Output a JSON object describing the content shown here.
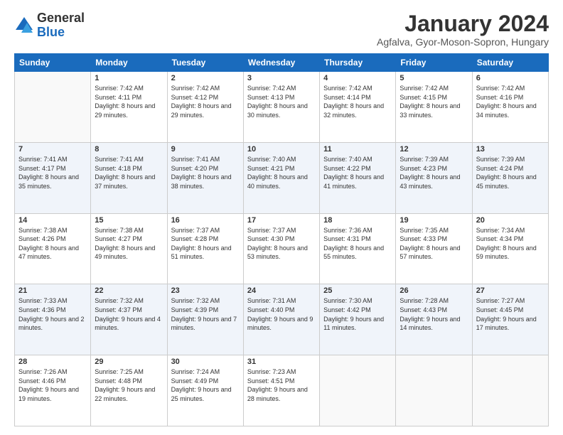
{
  "logo": {
    "general": "General",
    "blue": "Blue"
  },
  "header": {
    "month": "January 2024",
    "location": "Agfalva, Gyor-Moson-Sopron, Hungary"
  },
  "weekdays": [
    "Sunday",
    "Monday",
    "Tuesday",
    "Wednesday",
    "Thursday",
    "Friday",
    "Saturday"
  ],
  "weeks": [
    [
      {
        "day": "",
        "sunrise": "",
        "sunset": "",
        "daylight": ""
      },
      {
        "day": "1",
        "sunrise": "Sunrise: 7:42 AM",
        "sunset": "Sunset: 4:11 PM",
        "daylight": "Daylight: 8 hours and 29 minutes."
      },
      {
        "day": "2",
        "sunrise": "Sunrise: 7:42 AM",
        "sunset": "Sunset: 4:12 PM",
        "daylight": "Daylight: 8 hours and 29 minutes."
      },
      {
        "day": "3",
        "sunrise": "Sunrise: 7:42 AM",
        "sunset": "Sunset: 4:13 PM",
        "daylight": "Daylight: 8 hours and 30 minutes."
      },
      {
        "day": "4",
        "sunrise": "Sunrise: 7:42 AM",
        "sunset": "Sunset: 4:14 PM",
        "daylight": "Daylight: 8 hours and 32 minutes."
      },
      {
        "day": "5",
        "sunrise": "Sunrise: 7:42 AM",
        "sunset": "Sunset: 4:15 PM",
        "daylight": "Daylight: 8 hours and 33 minutes."
      },
      {
        "day": "6",
        "sunrise": "Sunrise: 7:42 AM",
        "sunset": "Sunset: 4:16 PM",
        "daylight": "Daylight: 8 hours and 34 minutes."
      }
    ],
    [
      {
        "day": "7",
        "sunrise": "Sunrise: 7:41 AM",
        "sunset": "Sunset: 4:17 PM",
        "daylight": "Daylight: 8 hours and 35 minutes."
      },
      {
        "day": "8",
        "sunrise": "Sunrise: 7:41 AM",
        "sunset": "Sunset: 4:18 PM",
        "daylight": "Daylight: 8 hours and 37 minutes."
      },
      {
        "day": "9",
        "sunrise": "Sunrise: 7:41 AM",
        "sunset": "Sunset: 4:20 PM",
        "daylight": "Daylight: 8 hours and 38 minutes."
      },
      {
        "day": "10",
        "sunrise": "Sunrise: 7:40 AM",
        "sunset": "Sunset: 4:21 PM",
        "daylight": "Daylight: 8 hours and 40 minutes."
      },
      {
        "day": "11",
        "sunrise": "Sunrise: 7:40 AM",
        "sunset": "Sunset: 4:22 PM",
        "daylight": "Daylight: 8 hours and 41 minutes."
      },
      {
        "day": "12",
        "sunrise": "Sunrise: 7:39 AM",
        "sunset": "Sunset: 4:23 PM",
        "daylight": "Daylight: 8 hours and 43 minutes."
      },
      {
        "day": "13",
        "sunrise": "Sunrise: 7:39 AM",
        "sunset": "Sunset: 4:24 PM",
        "daylight": "Daylight: 8 hours and 45 minutes."
      }
    ],
    [
      {
        "day": "14",
        "sunrise": "Sunrise: 7:38 AM",
        "sunset": "Sunset: 4:26 PM",
        "daylight": "Daylight: 8 hours and 47 minutes."
      },
      {
        "day": "15",
        "sunrise": "Sunrise: 7:38 AM",
        "sunset": "Sunset: 4:27 PM",
        "daylight": "Daylight: 8 hours and 49 minutes."
      },
      {
        "day": "16",
        "sunrise": "Sunrise: 7:37 AM",
        "sunset": "Sunset: 4:28 PM",
        "daylight": "Daylight: 8 hours and 51 minutes."
      },
      {
        "day": "17",
        "sunrise": "Sunrise: 7:37 AM",
        "sunset": "Sunset: 4:30 PM",
        "daylight": "Daylight: 8 hours and 53 minutes."
      },
      {
        "day": "18",
        "sunrise": "Sunrise: 7:36 AM",
        "sunset": "Sunset: 4:31 PM",
        "daylight": "Daylight: 8 hours and 55 minutes."
      },
      {
        "day": "19",
        "sunrise": "Sunrise: 7:35 AM",
        "sunset": "Sunset: 4:33 PM",
        "daylight": "Daylight: 8 hours and 57 minutes."
      },
      {
        "day": "20",
        "sunrise": "Sunrise: 7:34 AM",
        "sunset": "Sunset: 4:34 PM",
        "daylight": "Daylight: 8 hours and 59 minutes."
      }
    ],
    [
      {
        "day": "21",
        "sunrise": "Sunrise: 7:33 AM",
        "sunset": "Sunset: 4:36 PM",
        "daylight": "Daylight: 9 hours and 2 minutes."
      },
      {
        "day": "22",
        "sunrise": "Sunrise: 7:32 AM",
        "sunset": "Sunset: 4:37 PM",
        "daylight": "Daylight: 9 hours and 4 minutes."
      },
      {
        "day": "23",
        "sunrise": "Sunrise: 7:32 AM",
        "sunset": "Sunset: 4:39 PM",
        "daylight": "Daylight: 9 hours and 7 minutes."
      },
      {
        "day": "24",
        "sunrise": "Sunrise: 7:31 AM",
        "sunset": "Sunset: 4:40 PM",
        "daylight": "Daylight: 9 hours and 9 minutes."
      },
      {
        "day": "25",
        "sunrise": "Sunrise: 7:30 AM",
        "sunset": "Sunset: 4:42 PM",
        "daylight": "Daylight: 9 hours and 11 minutes."
      },
      {
        "day": "26",
        "sunrise": "Sunrise: 7:28 AM",
        "sunset": "Sunset: 4:43 PM",
        "daylight": "Daylight: 9 hours and 14 minutes."
      },
      {
        "day": "27",
        "sunrise": "Sunrise: 7:27 AM",
        "sunset": "Sunset: 4:45 PM",
        "daylight": "Daylight: 9 hours and 17 minutes."
      }
    ],
    [
      {
        "day": "28",
        "sunrise": "Sunrise: 7:26 AM",
        "sunset": "Sunset: 4:46 PM",
        "daylight": "Daylight: 9 hours and 19 minutes."
      },
      {
        "day": "29",
        "sunrise": "Sunrise: 7:25 AM",
        "sunset": "Sunset: 4:48 PM",
        "daylight": "Daylight: 9 hours and 22 minutes."
      },
      {
        "day": "30",
        "sunrise": "Sunrise: 7:24 AM",
        "sunset": "Sunset: 4:49 PM",
        "daylight": "Daylight: 9 hours and 25 minutes."
      },
      {
        "day": "31",
        "sunrise": "Sunrise: 7:23 AM",
        "sunset": "Sunset: 4:51 PM",
        "daylight": "Daylight: 9 hours and 28 minutes."
      },
      {
        "day": "",
        "sunrise": "",
        "sunset": "",
        "daylight": ""
      },
      {
        "day": "",
        "sunrise": "",
        "sunset": "",
        "daylight": ""
      },
      {
        "day": "",
        "sunrise": "",
        "sunset": "",
        "daylight": ""
      }
    ]
  ]
}
